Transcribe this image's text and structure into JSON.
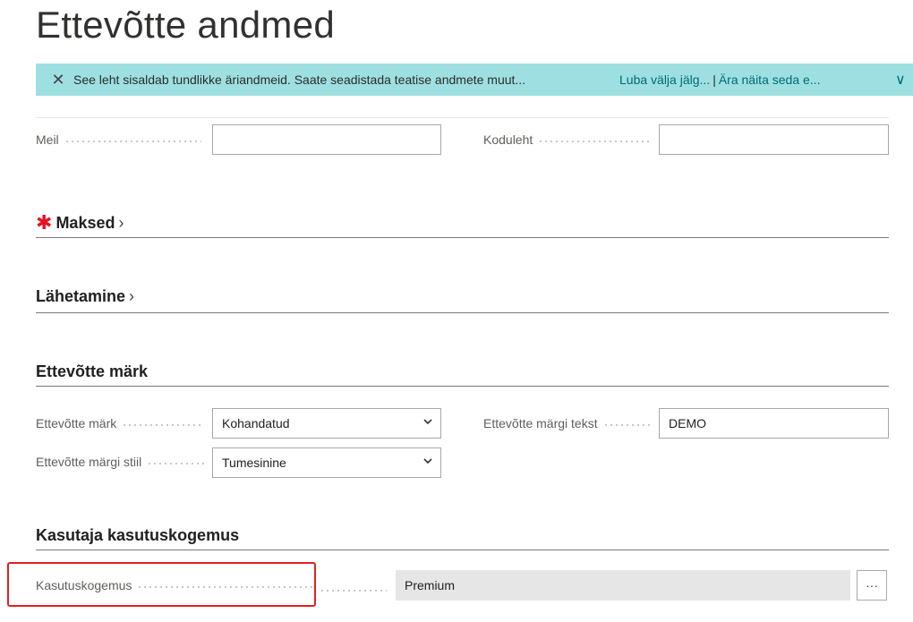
{
  "page": {
    "title": "Ettevõtte andmed"
  },
  "banner": {
    "close_glyph": "✕",
    "message": "See leht sisaldab tundlikke äriandmeid. Saate seadistada teatise andmete muut...",
    "link_enable": "Luba välja jälg...",
    "separator": "|",
    "link_hide": "Ära näita seda e...",
    "expand_glyph": "∨",
    "background_color": "#9ee0e2"
  },
  "contact": {
    "email_label": "Meil",
    "email_value": "",
    "homepage_label": "Koduleht",
    "homepage_value": ""
  },
  "sections": {
    "payments": {
      "title": "Maksed",
      "required_mark": "✱",
      "chevron": "›"
    },
    "shipping": {
      "title": "Lähetamine",
      "chevron": "›"
    },
    "badge": {
      "title": "Ettevõtte märk"
    },
    "experience": {
      "title": "Kasutaja kasutuskogemus"
    }
  },
  "badge": {
    "badge_label": "Ettevõtte märk",
    "badge_value": "Kohandatud",
    "badge_text_label": "Ettevõtte märgi tekst",
    "badge_text_value": "DEMO",
    "badge_style_label": "Ettevõtte märgi stiil",
    "badge_style_value": "Tumesinine"
  },
  "experience": {
    "label": "Kasutuskogemus",
    "value": "Premium",
    "assist_glyph": "···",
    "highlight_color": "#e02020"
  }
}
